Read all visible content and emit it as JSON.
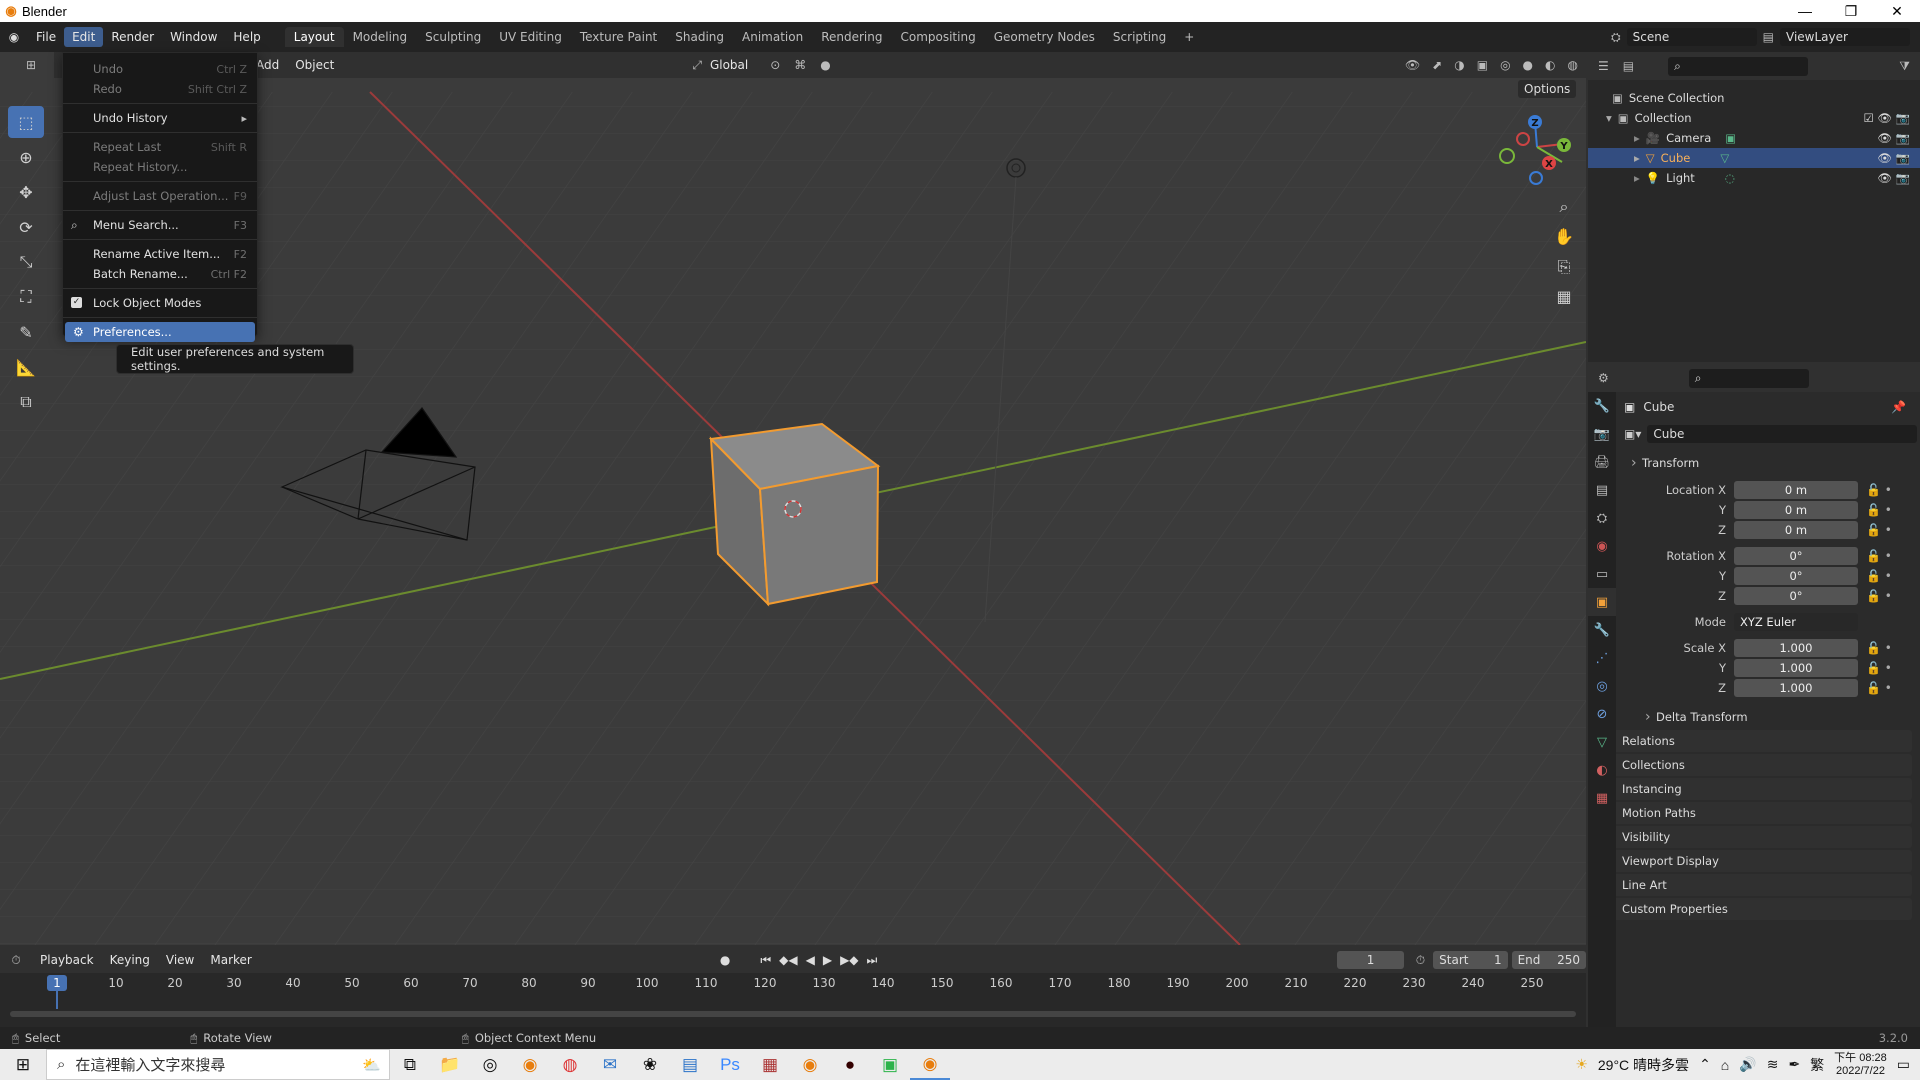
{
  "window": {
    "title": "Blender",
    "controls": [
      "—",
      "❐",
      "✕"
    ]
  },
  "topbar": {
    "menus": [
      "File",
      "Edit",
      "Render",
      "Window",
      "Help"
    ],
    "workspaces": [
      "Layout",
      "Modeling",
      "Sculpting",
      "UV Editing",
      "Texture Paint",
      "Shading",
      "Animation",
      "Rendering",
      "Compositing",
      "Geometry Nodes",
      "Scripting",
      "+"
    ],
    "scene": "Scene",
    "view_layer": "ViewLayer"
  },
  "viewport_header": {
    "add": "Add",
    "object": "Object",
    "orientation": "Global",
    "options": "Options"
  },
  "edit_menu": {
    "items": [
      {
        "label": "Undo",
        "shortcut": "Ctrl Z"
      },
      {
        "label": "Redo",
        "shortcut": "Shift Ctrl Z"
      },
      {
        "label": "Undo History",
        "shortcut": "▸"
      },
      {
        "label": "Repeat Last",
        "shortcut": "Shift R"
      },
      {
        "label": "Repeat History...",
        "shortcut": ""
      },
      {
        "label": "Adjust Last Operation...",
        "shortcut": "F9"
      },
      {
        "label": "Menu Search...",
        "shortcut": "F3"
      },
      {
        "label": "Rename Active Item...",
        "shortcut": "F2"
      },
      {
        "label": "Batch Rename...",
        "shortcut": "Ctrl F2"
      },
      {
        "label": "Lock Object Modes",
        "shortcut": ""
      },
      {
        "label": "Preferences...",
        "shortcut": ""
      }
    ],
    "tooltip": "Edit user preferences and system settings."
  },
  "outliner": {
    "root": "Scene Collection",
    "collection": "Collection",
    "items": [
      "Camera",
      "Cube",
      "Light"
    ]
  },
  "properties": {
    "object_name": "Cube",
    "datablock": "Cube",
    "transform_header": "Transform",
    "location_label": "Location X",
    "rotation_label": "Rotation X",
    "scale_label": "Scale X",
    "y": "Y",
    "z": "Z",
    "location": [
      "0 m",
      "0 m",
      "0 m"
    ],
    "rotation": [
      "0°",
      "0°",
      "0°"
    ],
    "mode_label": "Mode",
    "mode_value": "XYZ Euler",
    "scale": [
      "1.000",
      "1.000",
      "1.000"
    ],
    "delta": "Delta Transform",
    "panels": [
      "Relations",
      "Collections",
      "Instancing",
      "Motion Paths",
      "Visibility",
      "Viewport Display",
      "Line Art",
      "Custom Properties"
    ]
  },
  "timeline": {
    "menus": [
      "Playback",
      "Keying",
      "View",
      "Marker"
    ],
    "current_frame": "1",
    "start_label": "Start",
    "start": "1",
    "end_label": "End",
    "end": "250",
    "ticks": [
      "1",
      "10",
      "20",
      "30",
      "40",
      "50",
      "60",
      "70",
      "80",
      "90",
      "100",
      "110",
      "120",
      "130",
      "140",
      "150",
      "160",
      "170",
      "180",
      "190",
      "200",
      "210",
      "220",
      "230",
      "240",
      "250"
    ]
  },
  "statusbar": {
    "select": "Select",
    "rotate": "Rotate View",
    "context": "Object Context Menu",
    "version": "3.2.0"
  },
  "taskbar": {
    "search_placeholder": "在這裡輸入文字來搜尋",
    "weather": "29°C 晴時多雲",
    "lang": "繁",
    "time": "下午 08:28",
    "date": "2022/7/22"
  }
}
